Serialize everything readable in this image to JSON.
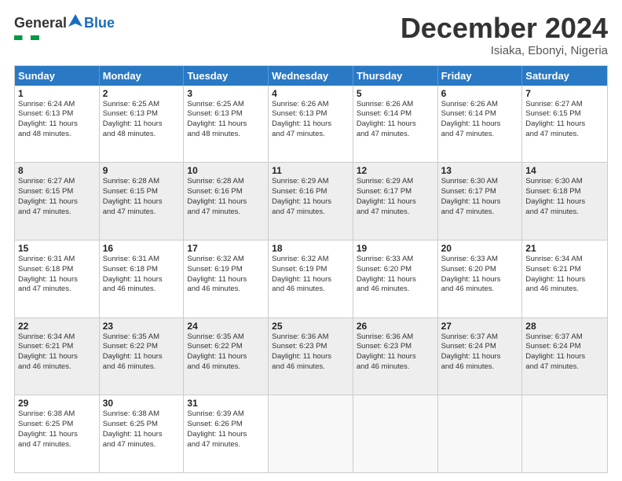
{
  "logo": {
    "general": "General",
    "blue": "Blue"
  },
  "title": "December 2024",
  "location": "Isiaka, Ebonyi, Nigeria",
  "days_header": [
    "Sunday",
    "Monday",
    "Tuesday",
    "Wednesday",
    "Thursday",
    "Friday",
    "Saturday"
  ],
  "weeks": [
    [
      {
        "day": "1",
        "l1": "Sunrise: 6:24 AM",
        "l2": "Sunset: 6:13 PM",
        "l3": "Daylight: 11 hours",
        "l4": "and 48 minutes.",
        "shaded": false
      },
      {
        "day": "2",
        "l1": "Sunrise: 6:25 AM",
        "l2": "Sunset: 6:13 PM",
        "l3": "Daylight: 11 hours",
        "l4": "and 48 minutes.",
        "shaded": false
      },
      {
        "day": "3",
        "l1": "Sunrise: 6:25 AM",
        "l2": "Sunset: 6:13 PM",
        "l3": "Daylight: 11 hours",
        "l4": "and 48 minutes.",
        "shaded": false
      },
      {
        "day": "4",
        "l1": "Sunrise: 6:26 AM",
        "l2": "Sunset: 6:13 PM",
        "l3": "Daylight: 11 hours",
        "l4": "and 47 minutes.",
        "shaded": false
      },
      {
        "day": "5",
        "l1": "Sunrise: 6:26 AM",
        "l2": "Sunset: 6:14 PM",
        "l3": "Daylight: 11 hours",
        "l4": "and 47 minutes.",
        "shaded": false
      },
      {
        "day": "6",
        "l1": "Sunrise: 6:26 AM",
        "l2": "Sunset: 6:14 PM",
        "l3": "Daylight: 11 hours",
        "l4": "and 47 minutes.",
        "shaded": false
      },
      {
        "day": "7",
        "l1": "Sunrise: 6:27 AM",
        "l2": "Sunset: 6:15 PM",
        "l3": "Daylight: 11 hours",
        "l4": "and 47 minutes.",
        "shaded": false
      }
    ],
    [
      {
        "day": "8",
        "l1": "Sunrise: 6:27 AM",
        "l2": "Sunset: 6:15 PM",
        "l3": "Daylight: 11 hours",
        "l4": "and 47 minutes.",
        "shaded": true
      },
      {
        "day": "9",
        "l1": "Sunrise: 6:28 AM",
        "l2": "Sunset: 6:15 PM",
        "l3": "Daylight: 11 hours",
        "l4": "and 47 minutes.",
        "shaded": true
      },
      {
        "day": "10",
        "l1": "Sunrise: 6:28 AM",
        "l2": "Sunset: 6:16 PM",
        "l3": "Daylight: 11 hours",
        "l4": "and 47 minutes.",
        "shaded": true
      },
      {
        "day": "11",
        "l1": "Sunrise: 6:29 AM",
        "l2": "Sunset: 6:16 PM",
        "l3": "Daylight: 11 hours",
        "l4": "and 47 minutes.",
        "shaded": true
      },
      {
        "day": "12",
        "l1": "Sunrise: 6:29 AM",
        "l2": "Sunset: 6:17 PM",
        "l3": "Daylight: 11 hours",
        "l4": "and 47 minutes.",
        "shaded": true
      },
      {
        "day": "13",
        "l1": "Sunrise: 6:30 AM",
        "l2": "Sunset: 6:17 PM",
        "l3": "Daylight: 11 hours",
        "l4": "and 47 minutes.",
        "shaded": true
      },
      {
        "day": "14",
        "l1": "Sunrise: 6:30 AM",
        "l2": "Sunset: 6:18 PM",
        "l3": "Daylight: 11 hours",
        "l4": "and 47 minutes.",
        "shaded": true
      }
    ],
    [
      {
        "day": "15",
        "l1": "Sunrise: 6:31 AM",
        "l2": "Sunset: 6:18 PM",
        "l3": "Daylight: 11 hours",
        "l4": "and 47 minutes.",
        "shaded": false
      },
      {
        "day": "16",
        "l1": "Sunrise: 6:31 AM",
        "l2": "Sunset: 6:18 PM",
        "l3": "Daylight: 11 hours",
        "l4": "and 46 minutes.",
        "shaded": false
      },
      {
        "day": "17",
        "l1": "Sunrise: 6:32 AM",
        "l2": "Sunset: 6:19 PM",
        "l3": "Daylight: 11 hours",
        "l4": "and 46 minutes.",
        "shaded": false
      },
      {
        "day": "18",
        "l1": "Sunrise: 6:32 AM",
        "l2": "Sunset: 6:19 PM",
        "l3": "Daylight: 11 hours",
        "l4": "and 46 minutes.",
        "shaded": false
      },
      {
        "day": "19",
        "l1": "Sunrise: 6:33 AM",
        "l2": "Sunset: 6:20 PM",
        "l3": "Daylight: 11 hours",
        "l4": "and 46 minutes.",
        "shaded": false
      },
      {
        "day": "20",
        "l1": "Sunrise: 6:33 AM",
        "l2": "Sunset: 6:20 PM",
        "l3": "Daylight: 11 hours",
        "l4": "and 46 minutes.",
        "shaded": false
      },
      {
        "day": "21",
        "l1": "Sunrise: 6:34 AM",
        "l2": "Sunset: 6:21 PM",
        "l3": "Daylight: 11 hours",
        "l4": "and 46 minutes.",
        "shaded": false
      }
    ],
    [
      {
        "day": "22",
        "l1": "Sunrise: 6:34 AM",
        "l2": "Sunset: 6:21 PM",
        "l3": "Daylight: 11 hours",
        "l4": "and 46 minutes.",
        "shaded": true
      },
      {
        "day": "23",
        "l1": "Sunrise: 6:35 AM",
        "l2": "Sunset: 6:22 PM",
        "l3": "Daylight: 11 hours",
        "l4": "and 46 minutes.",
        "shaded": true
      },
      {
        "day": "24",
        "l1": "Sunrise: 6:35 AM",
        "l2": "Sunset: 6:22 PM",
        "l3": "Daylight: 11 hours",
        "l4": "and 46 minutes.",
        "shaded": true
      },
      {
        "day": "25",
        "l1": "Sunrise: 6:36 AM",
        "l2": "Sunset: 6:23 PM",
        "l3": "Daylight: 11 hours",
        "l4": "and 46 minutes.",
        "shaded": true
      },
      {
        "day": "26",
        "l1": "Sunrise: 6:36 AM",
        "l2": "Sunset: 6:23 PM",
        "l3": "Daylight: 11 hours",
        "l4": "and 46 minutes.",
        "shaded": true
      },
      {
        "day": "27",
        "l1": "Sunrise: 6:37 AM",
        "l2": "Sunset: 6:24 PM",
        "l3": "Daylight: 11 hours",
        "l4": "and 46 minutes.",
        "shaded": true
      },
      {
        "day": "28",
        "l1": "Sunrise: 6:37 AM",
        "l2": "Sunset: 6:24 PM",
        "l3": "Daylight: 11 hours",
        "l4": "and 47 minutes.",
        "shaded": true
      }
    ],
    [
      {
        "day": "29",
        "l1": "Sunrise: 6:38 AM",
        "l2": "Sunset: 6:25 PM",
        "l3": "Daylight: 11 hours",
        "l4": "and 47 minutes.",
        "shaded": false
      },
      {
        "day": "30",
        "l1": "Sunrise: 6:38 AM",
        "l2": "Sunset: 6:25 PM",
        "l3": "Daylight: 11 hours",
        "l4": "and 47 minutes.",
        "shaded": false
      },
      {
        "day": "31",
        "l1": "Sunrise: 6:39 AM",
        "l2": "Sunset: 6:26 PM",
        "l3": "Daylight: 11 hours",
        "l4": "and 47 minutes.",
        "shaded": false
      },
      {
        "day": "",
        "l1": "",
        "l2": "",
        "l3": "",
        "l4": "",
        "shaded": false,
        "empty": true
      },
      {
        "day": "",
        "l1": "",
        "l2": "",
        "l3": "",
        "l4": "",
        "shaded": false,
        "empty": true
      },
      {
        "day": "",
        "l1": "",
        "l2": "",
        "l3": "",
        "l4": "",
        "shaded": false,
        "empty": true
      },
      {
        "day": "",
        "l1": "",
        "l2": "",
        "l3": "",
        "l4": "",
        "shaded": false,
        "empty": true
      }
    ]
  ]
}
